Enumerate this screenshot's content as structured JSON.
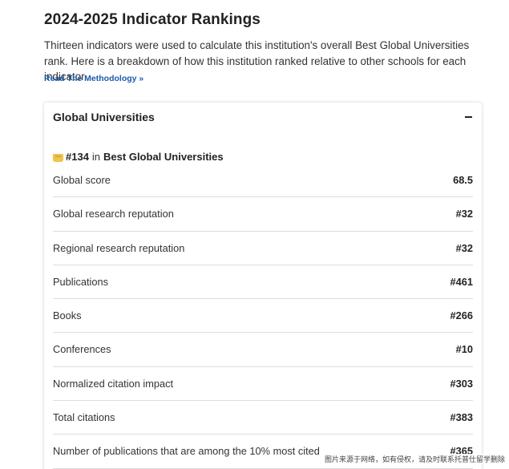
{
  "page": {
    "title": "2024-2025 Indicator Rankings",
    "intro": "Thirteen indicators were used to calculate this institution's overall Best Global Universities rank. Here is a breakdown of how this institution ranked relative to other schools for each indicator.",
    "methodology_link": "Read The Methodology »"
  },
  "card": {
    "title": "Global Universities",
    "rank": {
      "icon": "ranking-badge-icon",
      "number": "#134",
      "in": "in",
      "list_name": "Best Global Universities"
    },
    "rows": [
      {
        "label": "Global score",
        "value": "68.5"
      },
      {
        "label": "Global research reputation",
        "value": "#32"
      },
      {
        "label": "Regional research reputation",
        "value": "#32"
      },
      {
        "label": "Publications",
        "value": "#461"
      },
      {
        "label": "Books",
        "value": "#266"
      },
      {
        "label": "Conferences",
        "value": "#10"
      },
      {
        "label": "Normalized citation impact",
        "value": "#303"
      },
      {
        "label": "Total citations",
        "value": "#383"
      },
      {
        "label": "Number of publications that are among the 10% most cited",
        "value": "#365"
      }
    ]
  },
  "watermark": "图片来源于网络，如有侵权，请及时联系托普仕留学删除",
  "colors": {
    "link": "#1d5bab",
    "badge": "#f0c24f",
    "divider": "#dddddd"
  }
}
